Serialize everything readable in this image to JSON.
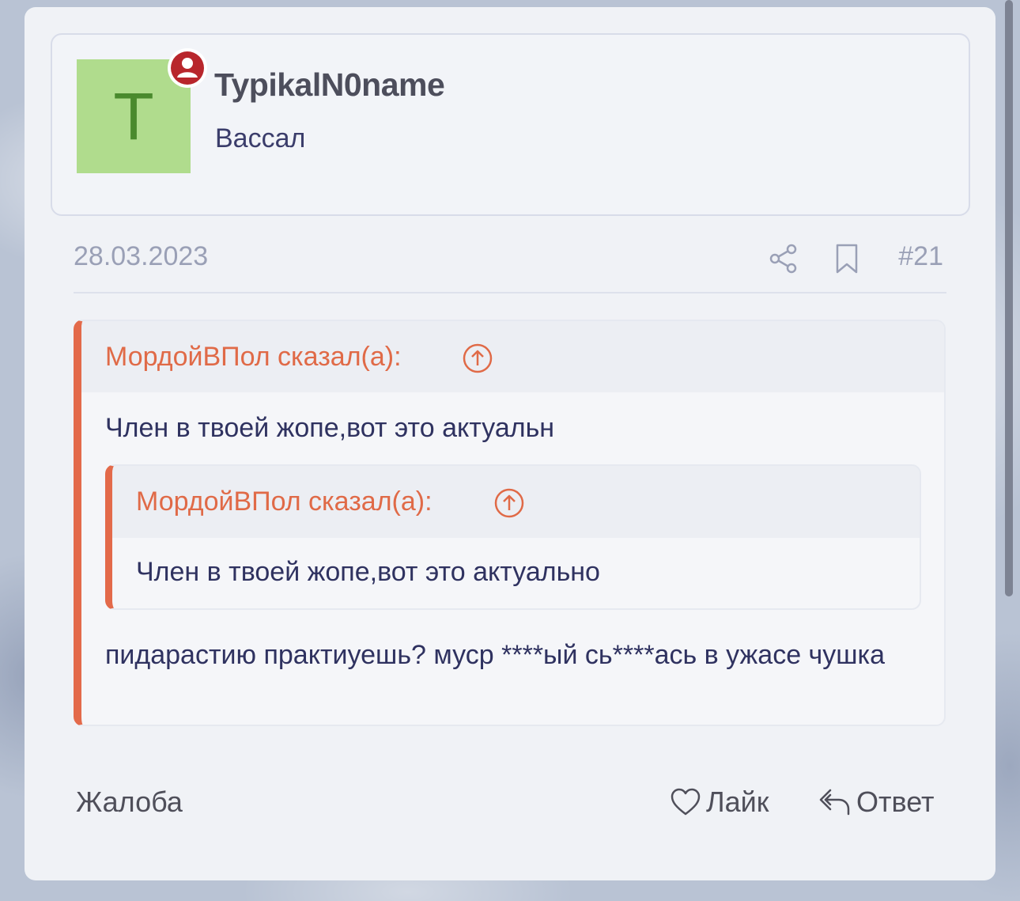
{
  "post": {
    "username": "TypikalN0name",
    "user_title": "Вассал",
    "avatar_letter": "T",
    "avatar_color": "#b0dc8d",
    "online_badge_color": "#b8262c",
    "date": "28.03.2023",
    "post_number": "#21"
  },
  "quote": {
    "author": "МордойВПол сказал(а):",
    "text": "Член в твоей жопе,вот это актуальн",
    "nested": {
      "author": "МордойВПол сказал(а):",
      "text": "Член в твоей жопе,вот это актуально"
    },
    "accent_color": "#e36a4a"
  },
  "reply_text": "пидарастию практиуешь? муср ****ый сь****ась в ужасе чушка",
  "actions": {
    "complain_label": "Жалоба",
    "like_label": "Лайк",
    "reply_label": "Ответ"
  },
  "icons": {
    "share": "share-icon",
    "bookmark": "bookmark-icon",
    "up_arrow": "arrow-up-circle-icon",
    "heart": "heart-icon",
    "reply": "reply-arrow-icon",
    "online": "user-online-icon"
  }
}
